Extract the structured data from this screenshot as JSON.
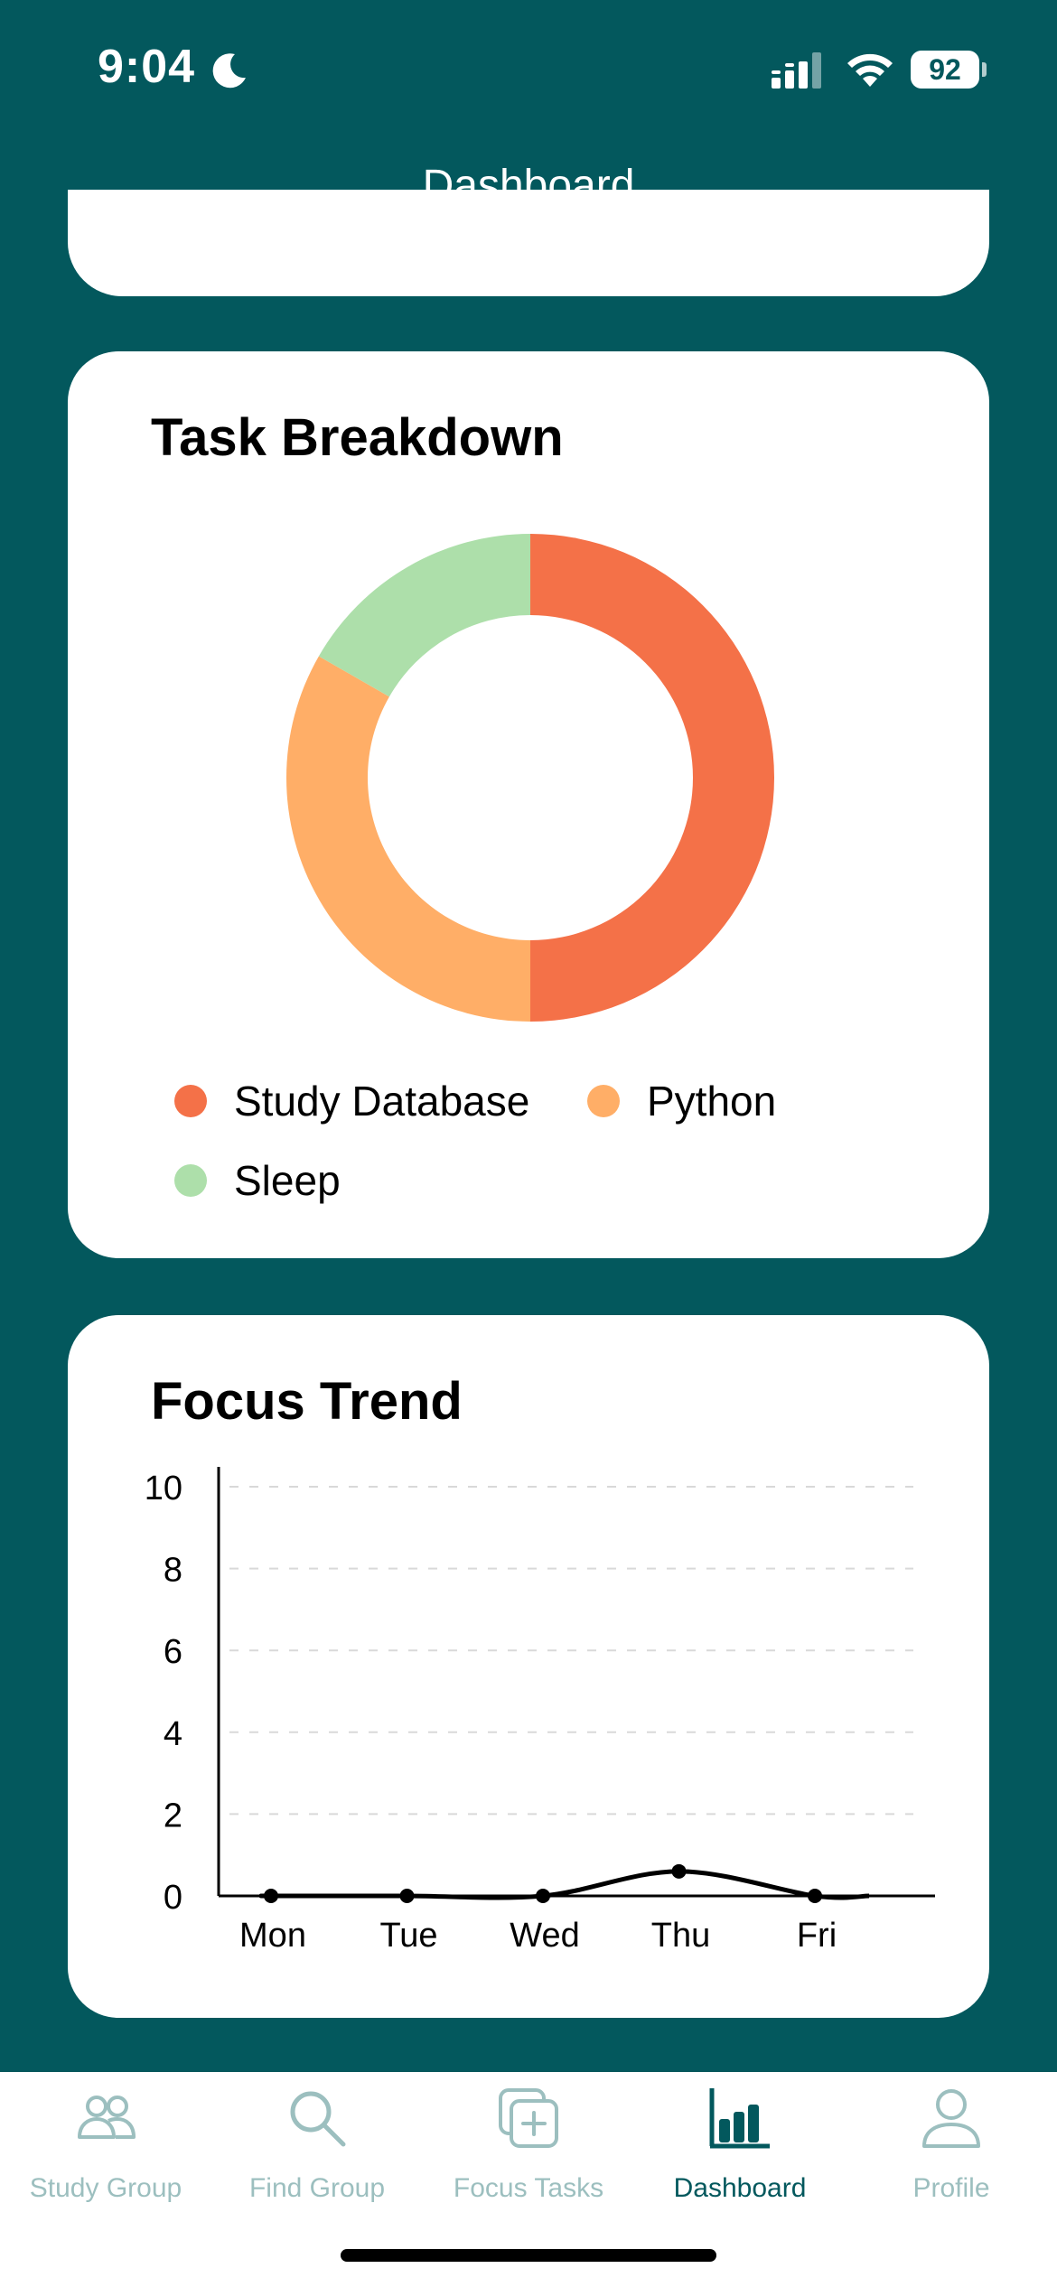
{
  "status_bar": {
    "time": "9:04",
    "battery": "92"
  },
  "header": {
    "title": "Dashboard"
  },
  "task_breakdown": {
    "title": "Task Breakdown",
    "legend": [
      {
        "label": "Study Database",
        "color": "#F47148"
      },
      {
        "label": "Python",
        "color": "#FFAE67"
      },
      {
        "label": "Sleep",
        "color": "#ADDFAA"
      }
    ]
  },
  "focus_trend": {
    "title": "Focus Trend"
  },
  "chart_data": [
    {
      "type": "pie",
      "title": "Task Breakdown",
      "labels": [
        "Study Database",
        "Python",
        "Sleep"
      ],
      "values": [
        50,
        33.3,
        16.7
      ],
      "colors": [
        "#F47148",
        "#FFAE67",
        "#ADDFAA"
      ],
      "donut": true,
      "legend_placement": "bottom"
    },
    {
      "type": "line",
      "title": "Focus Trend",
      "categories": [
        "Mon",
        "Tue",
        "Wed",
        "Thu",
        "Fri"
      ],
      "series": [
        {
          "values": [
            0,
            0,
            0,
            0.6,
            0
          ]
        }
      ],
      "yticks": [
        "0",
        "2",
        "4",
        "6",
        "8",
        "10"
      ],
      "ylim": [
        0,
        10
      ],
      "grid": true,
      "smooth": true
    }
  ],
  "tab_bar": {
    "tabs": [
      {
        "label": "Study Group",
        "icon": "people-icon",
        "active": false
      },
      {
        "label": "Find Group",
        "icon": "search-icon",
        "active": false
      },
      {
        "label": "Focus Tasks",
        "icon": "add-task-icon",
        "active": false
      },
      {
        "label": "Dashboard",
        "icon": "bar-chart-icon",
        "active": true
      },
      {
        "label": "Profile",
        "icon": "person-icon",
        "active": false
      }
    ]
  }
}
